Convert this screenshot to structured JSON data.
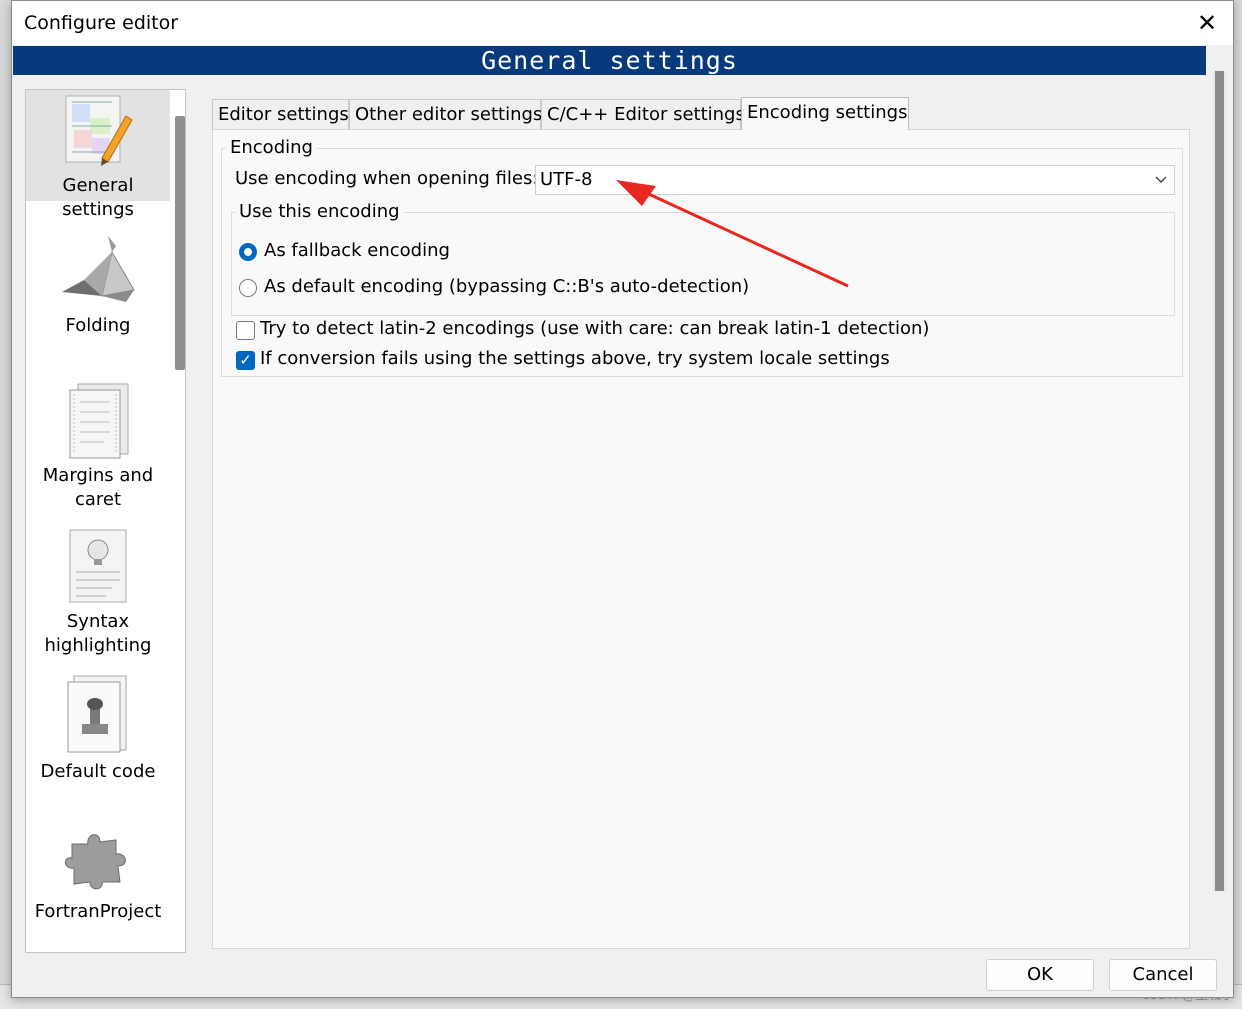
{
  "dialog": {
    "title": "Configure editor",
    "close_glyph": "✕",
    "header": "General settings"
  },
  "sidebar": {
    "items": [
      {
        "label": "General settings",
        "icon": "pencil-document-icon"
      },
      {
        "label": "Folding",
        "icon": "origami-bird-icon"
      },
      {
        "label": "Margins and caret",
        "icon": "document-pages-icon"
      },
      {
        "label": "Syntax highlighting",
        "icon": "lightbulb-document-icon"
      },
      {
        "label": "Default code",
        "icon": "stamp-document-icon"
      },
      {
        "label": "FortranProject",
        "icon": "puzzle-piece-icon"
      }
    ],
    "selected": "General settings"
  },
  "tabs": [
    {
      "label": "Editor settings"
    },
    {
      "label": "Other editor settings"
    },
    {
      "label": "C/C++ Editor settings"
    },
    {
      "label": "Encoding settings",
      "active": true
    }
  ],
  "encoding": {
    "group_label": "Encoding",
    "open_label": "Use encoding when opening files:",
    "selected_value": "UTF-8",
    "use_group_label": "Use this encoding",
    "radio_fallback": "As fallback encoding",
    "radio_default": "As default encoding (bypassing C::B's auto-detection)",
    "check_latin2": "Try to detect latin-2 encodings (use with care: can break latin-1 detection)",
    "check_locale": "If conversion fails using the settings above, try system locale settings",
    "check_mark": "✓"
  },
  "buttons": {
    "ok": "OK",
    "cancel": "Cancel"
  },
  "background": {
    "watermark": "CSDN @星城子"
  },
  "colors": {
    "banner": "#063a7d",
    "accent": "#0067c0",
    "annotation_arrow": "#e8281f"
  }
}
